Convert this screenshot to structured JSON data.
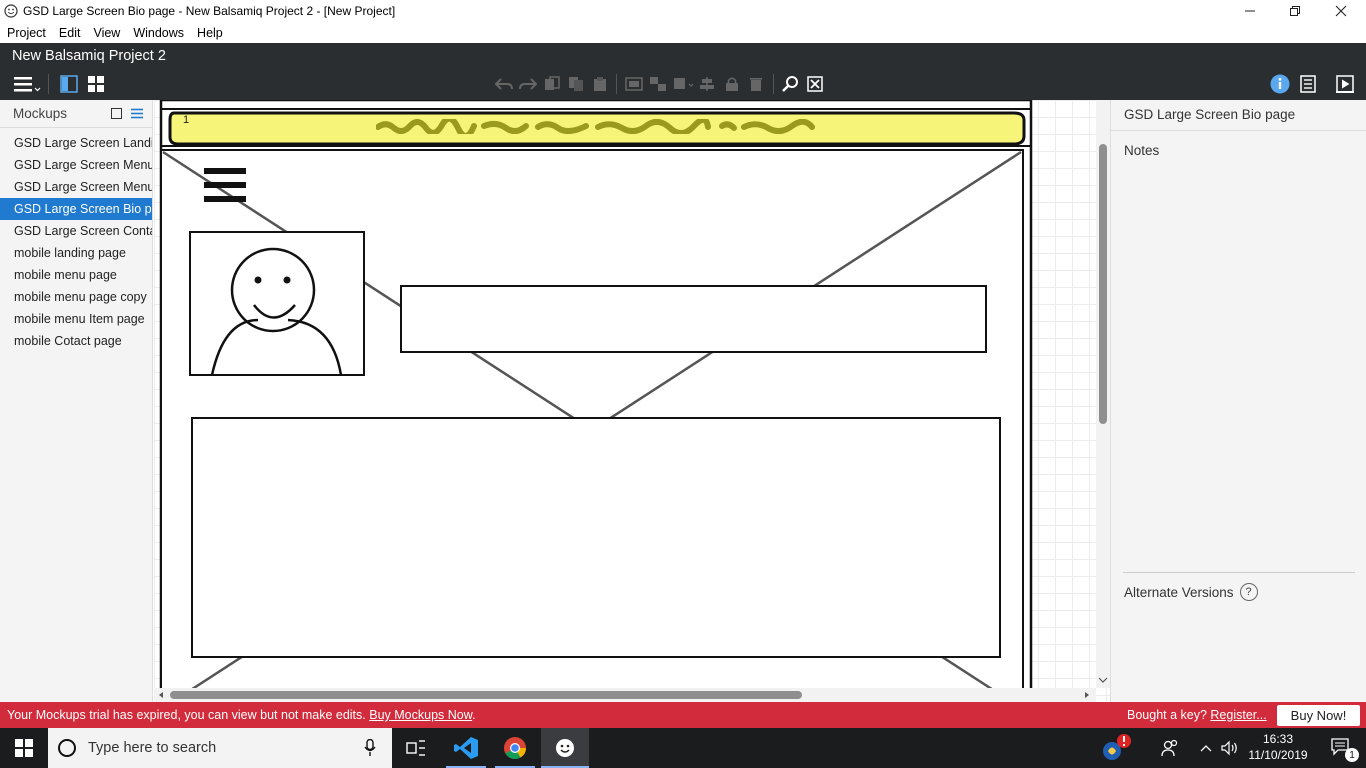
{
  "window": {
    "title": "GSD Large Screen Bio page  - New Balsamiq Project 2 - [New Project]"
  },
  "menubar": {
    "items": [
      "Project",
      "Edit",
      "View",
      "Windows",
      "Help"
    ]
  },
  "header": {
    "project_name": "New Balsamiq Project 2"
  },
  "left_panel": {
    "title": "Mockups",
    "items": [
      "GSD Large Screen Landi",
      "GSD Large Screen Menu",
      "GSD Large Screen Menu",
      "GSD Large Screen Bio pa",
      "GSD Large Screen Conta",
      "mobile landing page",
      "mobile menu page",
      "mobile menu page copy",
      "mobile menu Item page",
      "mobile Cotact page"
    ],
    "selected_index": 3
  },
  "canvas": {
    "page_label": "1"
  },
  "right_panel": {
    "mockup_title": "GSD Large Screen Bio page",
    "notes_label": "Notes",
    "alternate_versions_label": "Alternate Versions",
    "help_symbol": "?"
  },
  "banner": {
    "message": "Your Mockups trial has expired, you can view but not make edits.",
    "buy_link": "Buy Mockups Now",
    "buy_link_suffix": ".",
    "key_prompt": "Bought a key?",
    "register_link": "Register...",
    "buy_button": "Buy Now!"
  },
  "taskbar": {
    "search_placeholder": "Type here to search",
    "time": "16:33",
    "date": "11/10/2019",
    "notification_count": "1"
  },
  "colors": {
    "app_header": "#2b2e31",
    "selection": "#1f7ad0",
    "banner": "#d22b3b",
    "sketch_yellow": "#f6f57a"
  }
}
